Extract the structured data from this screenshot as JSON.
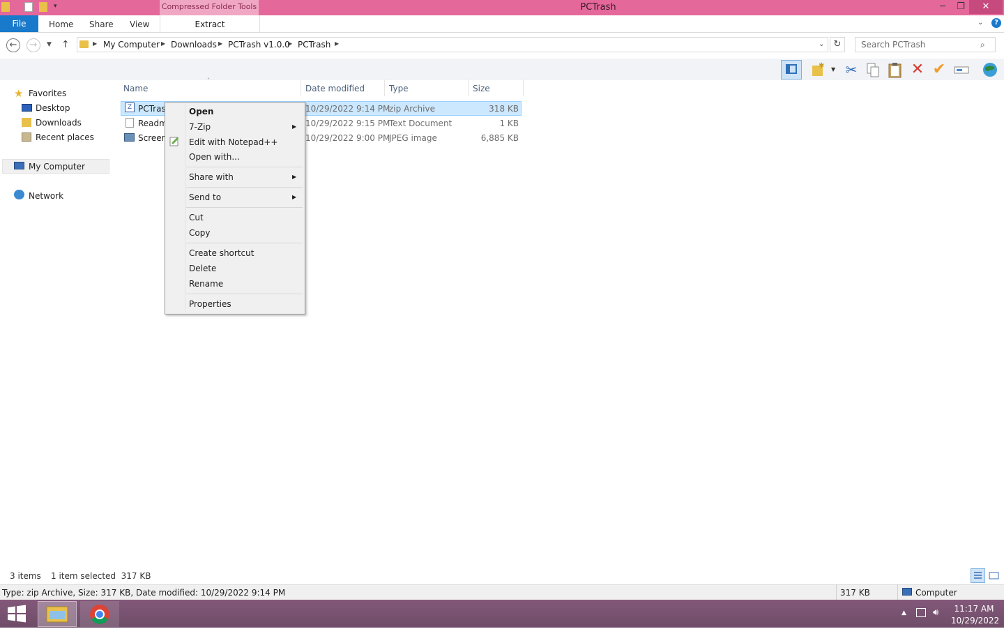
{
  "window": {
    "title": "PCTrash",
    "context_tab_header": "Compressed Folder Tools",
    "controls": {
      "minimize": "─",
      "restore": "❐",
      "close": "✕"
    }
  },
  "ribbon": {
    "file": "File",
    "tabs": [
      "Home",
      "Share",
      "View"
    ],
    "context_tab": "Extract",
    "help": "?"
  },
  "address": {
    "crumbs": [
      "My Computer",
      "Downloads",
      "PCTrash v1.0.0",
      "PCTrash"
    ],
    "search_placeholder": "Search PCTrash"
  },
  "nav_pane": {
    "favorites": "Favorites",
    "fav_items": [
      "Desktop",
      "Downloads",
      "Recent places"
    ],
    "computer": "My Computer",
    "network": "Network"
  },
  "columns": {
    "name": "Name",
    "date": "Date modified",
    "type": "Type",
    "size": "Size"
  },
  "files": [
    {
      "name": "PCTras",
      "date": "10/29/2022 9:14 PM",
      "type": "zip Archive",
      "size": "318 KB"
    },
    {
      "name": "Readm",
      "date": "10/29/2022 9:15 PM",
      "type": "Text Document",
      "size": "1 KB"
    },
    {
      "name": "Screen",
      "date": "10/29/2022 9:00 PM",
      "type": "JPEG image",
      "size": "6,885 KB"
    }
  ],
  "context_menu": {
    "open": "Open",
    "zip7": "7-Zip",
    "notepad": "Edit with Notepad++",
    "open_with": "Open with...",
    "share_with": "Share with",
    "send_to": "Send to",
    "cut": "Cut",
    "copy": "Copy",
    "create_shortcut": "Create shortcut",
    "delete": "Delete",
    "rename": "Rename",
    "properties": "Properties"
  },
  "status": {
    "items": "3 items",
    "selected": "1 item selected  317 KB",
    "details": "Type: zip Archive, Size: 317 KB, Date modified: 10/29/2022 9:14 PM",
    "size": "317 KB",
    "location": "Computer"
  },
  "taskbar": {
    "time": "11:17 AM",
    "date": "10/29/2022"
  },
  "colors": {
    "titlebar": "#e4689a",
    "file_tab": "#1979ca",
    "selection": "#cce8ff",
    "taskbar": "#7a5570"
  }
}
